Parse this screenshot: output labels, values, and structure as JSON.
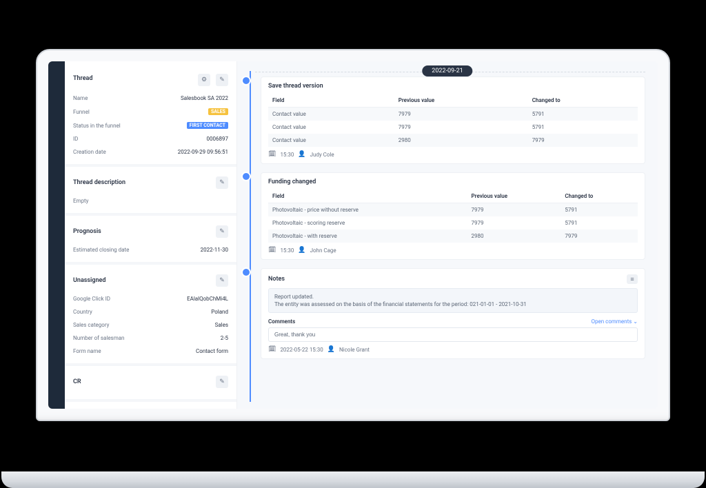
{
  "timeline_date": "2022-09-21",
  "thread": {
    "card_title": "Thread",
    "rows": [
      {
        "label": "Name",
        "value": "Salesbook SA 2022"
      },
      {
        "label": "Funnel",
        "badge": "SALES",
        "badge_class": "badge-yellow"
      },
      {
        "label": "Status in the funnel",
        "badge": "FIRST CONTACT",
        "badge_class": "badge-blue"
      },
      {
        "label": "ID",
        "value": "0006897"
      },
      {
        "label": "Creation date",
        "value": "2022-09-29 09:56:51"
      }
    ]
  },
  "description": {
    "card_title": "Thread description",
    "empty_text": "Empty"
  },
  "prognosis": {
    "card_title": "Prognosis",
    "label": "Estimated closing date",
    "value": "2022-11-30"
  },
  "unassigned": {
    "card_title": "Unassigned",
    "rows": [
      {
        "label": "Google Click ID",
        "value": "EAlalQobChMi4L"
      },
      {
        "label": "Country",
        "value": "Poland"
      },
      {
        "label": "Sales category",
        "value": "Sales"
      },
      {
        "label": "Number of salesman",
        "value": "2-5"
      },
      {
        "label": "Form name",
        "value": "Contact form"
      }
    ]
  },
  "cr": {
    "card_title": "CR"
  },
  "event1": {
    "title": "Save thread version",
    "columns": [
      "Field",
      "Previous value",
      "Changed to"
    ],
    "rows": [
      [
        "Contact value",
        "7979",
        "5791"
      ],
      [
        "Contact value",
        "7979",
        "5791"
      ],
      [
        "Contact value",
        "2980",
        "7979"
      ]
    ],
    "time": "15:30",
    "user": "Judy Cole"
  },
  "event2": {
    "title": "Funding changed",
    "columns": [
      "Field",
      "Previous value",
      "Changed to"
    ],
    "rows": [
      [
        "Photovoltaic - price without reserve",
        "7979",
        "5791"
      ],
      [
        "Photovoltaic - scoring reserve",
        "7979",
        "5791"
      ],
      [
        "Photovoltaic - with reserve",
        "2980",
        "7979"
      ]
    ],
    "time": "15:30",
    "user": "John Cage"
  },
  "event3": {
    "title": "Notes",
    "note_line1": "Report updated.",
    "note_line2": "The entity was assessed on the basis of the financial statements for the period: 021-01-01 - 2021-10-31",
    "comments_title": "Comments",
    "open_comments": "Open comments",
    "comment_value": "Great, thank you",
    "time": "2022-05-22 15:30",
    "user": "Nicole Grant"
  }
}
